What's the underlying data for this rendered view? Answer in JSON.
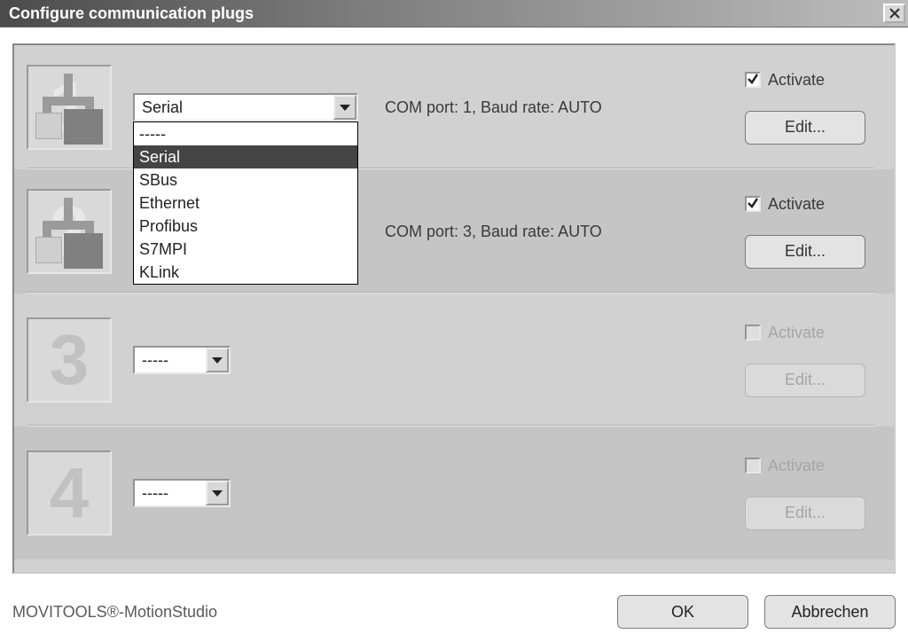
{
  "title": "Configure communication plugs",
  "footer": "MOVITOOLS®-MotionStudio",
  "buttons": {
    "ok": "OK",
    "cancel": "Abbrechen",
    "edit": "Edit..."
  },
  "labels": {
    "activate": "Activate"
  },
  "dropdown_options": [
    "-----",
    "Serial",
    "SBus",
    "Ethernet",
    "Profibus",
    "S7MPI",
    "KLink"
  ],
  "slots": [
    {
      "num": "1",
      "selected": "Serial",
      "status": "COM port: 1, Baud rate: AUTO",
      "checked": true,
      "enabled": true,
      "hasPlug": true,
      "open": true
    },
    {
      "num": "2",
      "selected": "",
      "status": "COM port: 3, Baud rate: AUTO",
      "checked": true,
      "enabled": true,
      "hasPlug": true,
      "alt": true
    },
    {
      "num": "3",
      "selected": "-----",
      "status": "",
      "checked": false,
      "enabled": false,
      "narrow": true
    },
    {
      "num": "4",
      "selected": "-----",
      "status": "",
      "checked": false,
      "enabled": false,
      "narrow": true,
      "alt": true
    }
  ]
}
